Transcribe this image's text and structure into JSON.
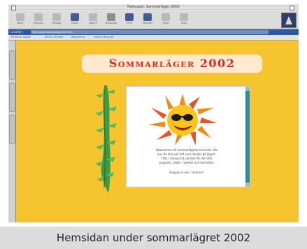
{
  "browser": {
    "window_title": "Netscape: Sommarläger 2002",
    "toolbar": [
      {
        "label": "Back",
        "icon": "back-icon"
      },
      {
        "label": "Forward",
        "icon": "forward-icon"
      },
      {
        "label": "Reload",
        "icon": "reload-icon"
      },
      {
        "label": "Home",
        "icon": "home-icon"
      },
      {
        "label": "Search",
        "icon": "search-icon"
      },
      {
        "label": "Netscape",
        "icon": "netscape-icon"
      },
      {
        "label": "Print",
        "icon": "print-icon"
      },
      {
        "label": "Security",
        "icon": "security-icon"
      },
      {
        "label": "Shop",
        "icon": "shop-icon"
      },
      {
        "label": "Stop",
        "icon": "stop-icon"
      }
    ],
    "location": {
      "label": "Location:",
      "url": "http://www.sommarlager2002.se/"
    },
    "personal_toolbar": [
      "Personal Toolbar",
      "What's Related",
      "Bookmarks",
      "Instant Message"
    ]
  },
  "page": {
    "title": "Sommarläger 2002",
    "body_lines": [
      "Välkommen till sommarlägrets hemsida. Här",
      "kan du läsa om allt som händer på lägret.",
      "Titta i menyn till vänster för att hitta",
      "program, bilder, nyheter och kontakter.",
      "",
      "Hoppas vi ses i sommar!"
    ]
  },
  "caption": "Hemsidan under sommarlägret 2002",
  "colors": {
    "page_background": "#f6c42e",
    "title_text": "#d82a24",
    "title_panel": "#ffe9cf",
    "location_bar": "#2a5a9b",
    "scrollbar": "#2d8ca0"
  }
}
